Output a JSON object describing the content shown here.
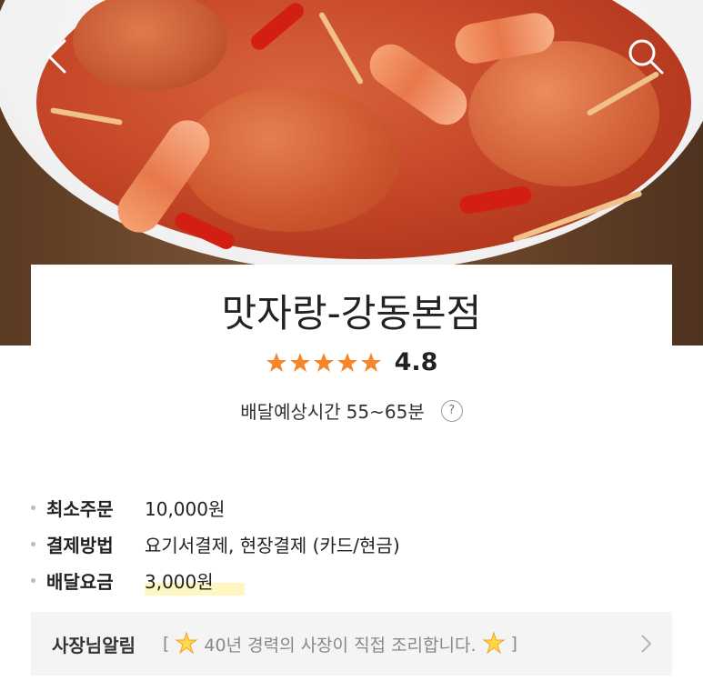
{
  "store": {
    "name": "맛자랑-강동본점",
    "rating": "4.8",
    "stars": 5,
    "delivery_label": "배달예상시간",
    "delivery_time": "55~65분",
    "help_icon": "?"
  },
  "info": {
    "min_order_label": "최소주문",
    "min_order_value": "10,000원",
    "payment_label": "결제방법",
    "payment_value": "요기서결제, 현장결제 (카드/현금)",
    "delivery_fee_label": "배달요금",
    "delivery_fee_value": "3,000원"
  },
  "notice": {
    "label": "사장님알림",
    "open_bracket": "[",
    "text": "40년 경력의 사장이 직접 조리합니다.",
    "close_bracket": "]"
  },
  "icons": {
    "back": "back-arrow-icon",
    "search": "search-icon",
    "star": "star-icon",
    "sparkle": "sparkle-icon",
    "chevron": "chevron-right-icon"
  },
  "colors": {
    "star": "#f5862b",
    "highlight": "#fff3a6",
    "notice_bg": "#f4f4f4"
  }
}
